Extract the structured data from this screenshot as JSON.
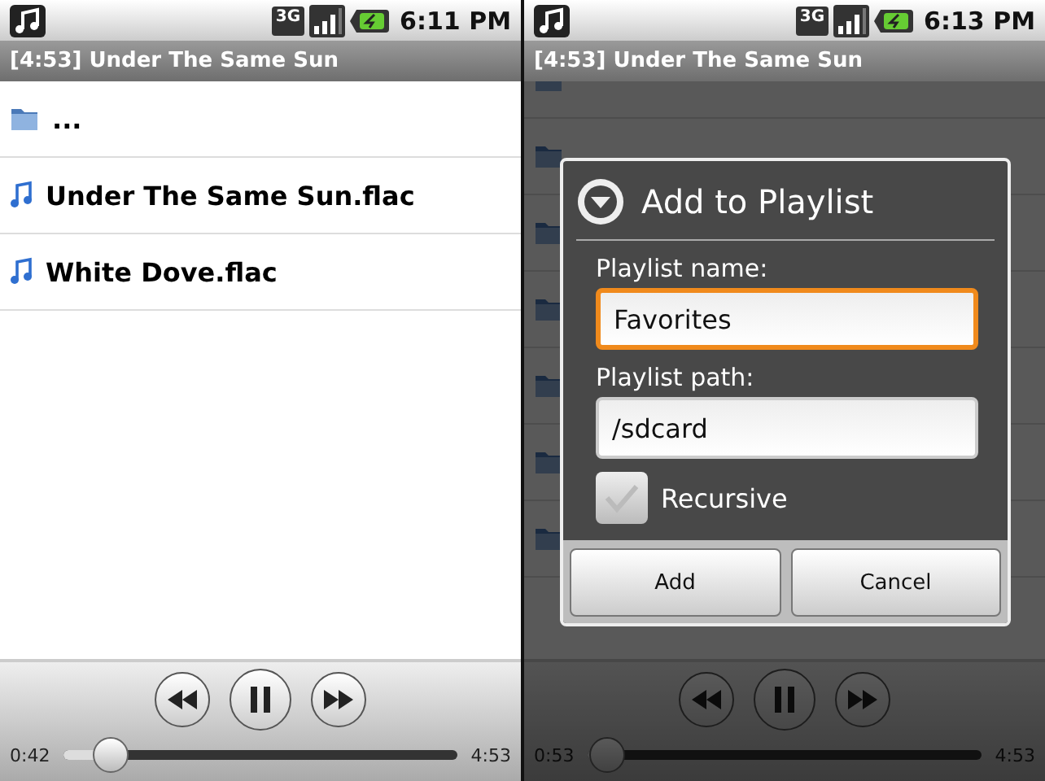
{
  "screens": [
    {
      "status_bar": {
        "network": "3G",
        "time": "6:11 PM"
      },
      "title": "[4:53] Under The Same Sun",
      "files": [
        {
          "kind": "folder",
          "name": "..."
        },
        {
          "kind": "audio",
          "name": "Under The Same Sun.flac"
        },
        {
          "kind": "audio",
          "name": "White Dove.flac"
        }
      ],
      "player": {
        "playing": true,
        "elapsed": "0:42",
        "total": "4:53",
        "level": 0.12
      }
    },
    {
      "status_bar": {
        "network": "3G",
        "time": "6:13 PM"
      },
      "title": "[4:53] Under The Same Sun",
      "files": [
        {
          "kind": "folder"
        },
        {
          "kind": "folder"
        },
        {
          "kind": "folder"
        },
        {
          "kind": "folder"
        },
        {
          "kind": "folder"
        },
        {
          "kind": "folder"
        },
        {
          "kind": "folder"
        }
      ],
      "player": {
        "playing": true,
        "elapsed": "0:53",
        "total": "4:53",
        "level": 0.05
      },
      "dialog": {
        "title": "Add to Playlist",
        "fields": [
          {
            "label": "Playlist name:",
            "value": "Favorites",
            "focused": true
          },
          {
            "label": "Playlist path:",
            "value": "/sdcard",
            "focused": false
          }
        ],
        "checkbox": {
          "label": "Recursive",
          "checked": true
        },
        "buttons": [
          "Add",
          "Cancel"
        ]
      }
    }
  ]
}
